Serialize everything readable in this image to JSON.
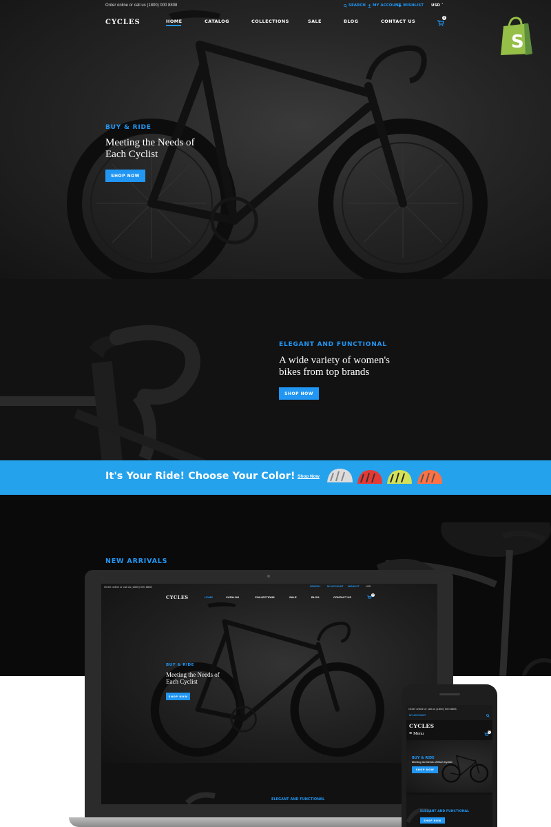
{
  "header": {
    "contact_text": "Order online or call us (1800) 000 8808",
    "utilities": [
      {
        "label": "SEARCH",
        "icon": "search-icon"
      },
      {
        "label": "MY ACCOUNT",
        "icon": "user-icon"
      },
      {
        "label": "WISHLIST",
        "icon": "heart-icon"
      }
    ],
    "currency": "USD",
    "logo": "CYCLES",
    "nav": [
      "HOME",
      "CATALOG",
      "COLLECTIONS",
      "SALE",
      "BLOG",
      "CONTACT US"
    ],
    "cart_count": "0"
  },
  "hero": {
    "eyebrow": "BUY & RIDE",
    "title_line1": "Meeting the Needs of",
    "title_line2": "Each Cyclist",
    "button": "SHOP NOW"
  },
  "feature": {
    "eyebrow": "ELEGANT AND FUNCTIONAL",
    "title_line1": "A wide variety of women's",
    "title_line2": "bikes from top brands",
    "button": "SHOP NOW"
  },
  "promo": {
    "headline": "It's Your Ride! Choose Your Color!",
    "link": "Shop Now",
    "helmet_colors": [
      "#d9d9d9",
      "#e53935",
      "#d4e157",
      "#ff7043"
    ]
  },
  "new_arrivals": {
    "heading": "NEW ARRIVALS"
  },
  "laptop_preview": {
    "contact_text": "Order online or call us (1800) 000 8808",
    "utilities": [
      "SEARCH",
      "MY ACCOUNT",
      "WISHLIST"
    ],
    "currency": "USD",
    "logo": "CYCLES",
    "nav": [
      "HOME",
      "CATALOG",
      "COLLECTIONS",
      "SALE",
      "BLOG",
      "CONTACT US"
    ],
    "cart_count": "0",
    "eyebrow": "BUY & RIDE",
    "title_line1": "Meeting the Needs of",
    "title_line2": "Each Cyclist",
    "button": "SHOP NOW",
    "feature_eyebrow": "ELEGANT AND FUNCTIONAL"
  },
  "phone_preview": {
    "contact_text": "Order online or call us (1800) 000 8808",
    "account": "MY ACCOUNT",
    "logo": "CYCLES",
    "menu": "Menu",
    "cart_count": "0",
    "eyebrow": "BUY & RIDE",
    "subtitle": "Meeting the Needs of Each Cyclist",
    "button": "SHOP NOW",
    "feature_eyebrow": "ELEGANT AND FUNCTIONAL",
    "feature_button": "SHOP NOW"
  },
  "colors": {
    "accent": "#2196f3",
    "promo_bg": "#25a2ec",
    "shopify_green": "#95bf47"
  }
}
